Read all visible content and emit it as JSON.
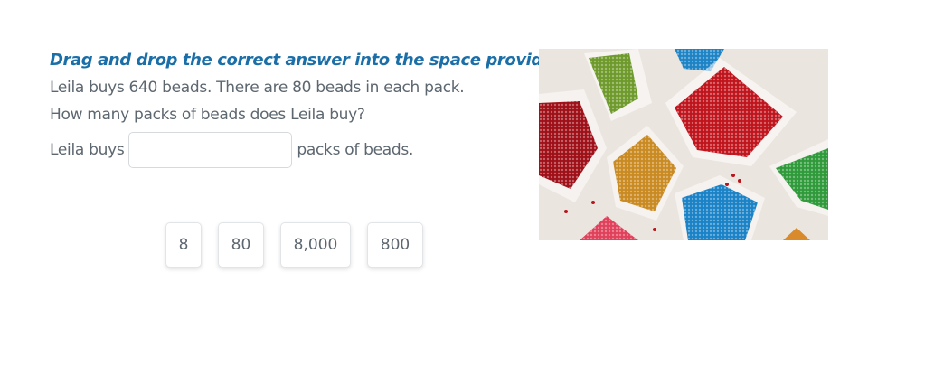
{
  "instruction": "Drag and drop the correct answer into the space provided.",
  "question": {
    "line1": "Leila buys 640 beads. There are 80 beads in each pack.",
    "line2": "How many packs of beads does Leila buy?"
  },
  "answer_sentence": {
    "prefix": "Leila buys",
    "drop_value": "",
    "suffix": "packs of beads."
  },
  "options": [
    "8",
    "80",
    "8,000",
    "800"
  ],
  "image": {
    "subject": "bags of colored beads",
    "colors": [
      "#b0141c",
      "#5a8a2a",
      "#c9891e",
      "#1a7fc0",
      "#2e9a3a",
      "#e0405a"
    ]
  }
}
